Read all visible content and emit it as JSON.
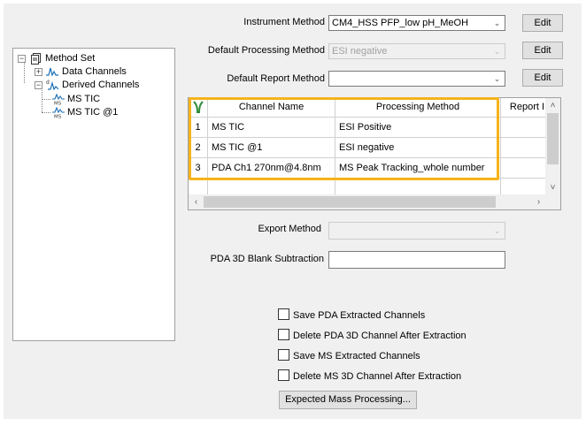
{
  "tree": {
    "root": "Method Set",
    "items": [
      {
        "label": "Data Channels"
      },
      {
        "label": "Derived Channels"
      },
      {
        "label": "MS TIC"
      },
      {
        "label": "MS TIC @1"
      }
    ]
  },
  "form": {
    "instrument_method_label": "Instrument Method",
    "instrument_method_value": "CM4_HSS PFP_low pH_MeOH",
    "processing_method_label": "Default Processing Method",
    "processing_method_value": "ESI negative",
    "report_method_label": "Default Report Method",
    "report_method_value": "",
    "edit_label": "Edit",
    "export_method_label": "Export Method",
    "export_method_value": "",
    "blank_subtraction_label": "PDA 3D Blank Subtraction",
    "blank_subtraction_value": ""
  },
  "grid": {
    "columns": [
      "Channel Name",
      "Processing Method",
      "Report I"
    ],
    "rows": [
      {
        "num": "1",
        "channel": "MS TIC",
        "processing": "ESI Positive",
        "report": ""
      },
      {
        "num": "2",
        "channel": "MS TIC @1",
        "processing": "ESI negative",
        "report": ""
      },
      {
        "num": "3",
        "channel": "PDA Ch1 270nm@4.8nm",
        "processing": "MS Peak Tracking_whole number",
        "report": ""
      }
    ],
    "highlight_color": "#f5b31b"
  },
  "options": {
    "save_pda": "Save PDA Extracted Channels",
    "delete_pda": "Delete PDA 3D Channel After Extraction",
    "save_ms": "Save MS Extracted Channels",
    "delete_ms": "Delete MS 3D Channel After Extraction",
    "expected_mass_button": "Expected Mass Processing..."
  }
}
